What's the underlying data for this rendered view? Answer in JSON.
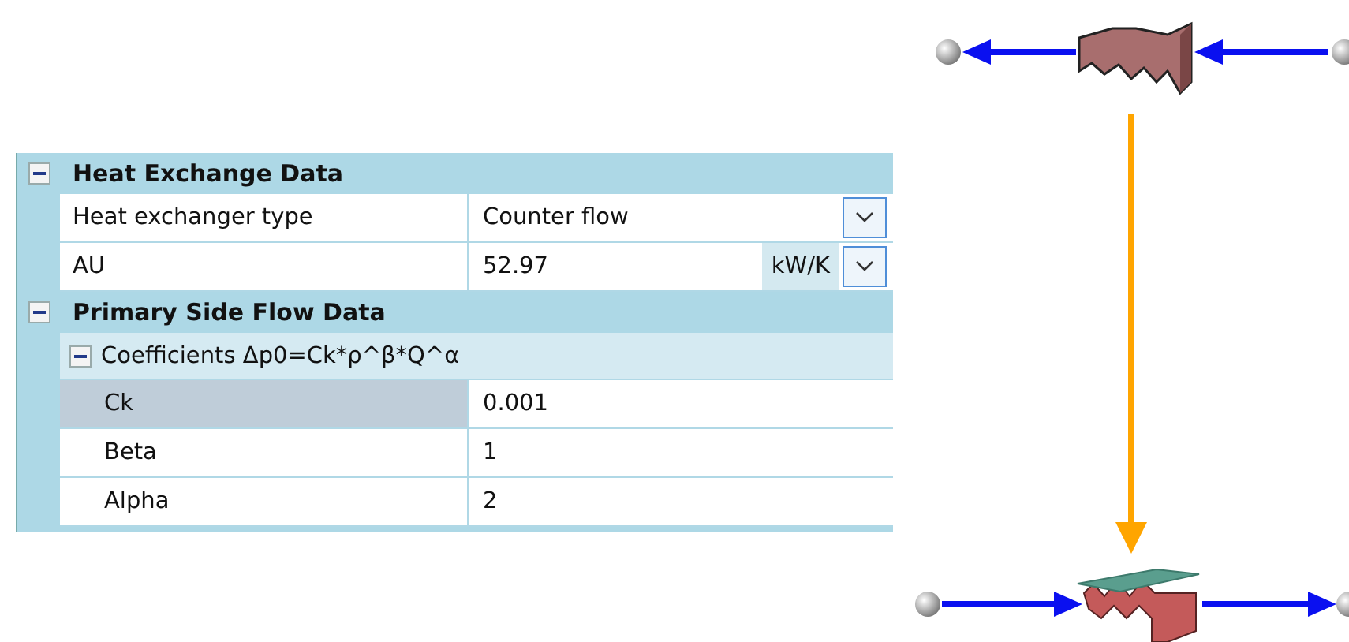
{
  "property_grid": {
    "categories": [
      {
        "title": "Heat Exchange Data",
        "expanded": true,
        "children": [
          {
            "kind": "property",
            "label": "Heat exchanger type",
            "value": "Counter flow",
            "dropdown": true,
            "selected": false
          },
          {
            "kind": "property",
            "label": "AU",
            "value": "52.97",
            "unit": "kW/K",
            "dropdown": true,
            "selected": false
          }
        ]
      },
      {
        "title": "Primary Side Flow Data",
        "expanded": true,
        "children": [
          {
            "kind": "group",
            "title": "Coefficients Δp0=Ck*ρ^β*Q^α",
            "expanded": true,
            "children": [
              {
                "kind": "property",
                "label": "Ck",
                "value": "0.001",
                "dropdown": false,
                "selected": true
              },
              {
                "kind": "property",
                "label": "Beta",
                "value": "1",
                "dropdown": false,
                "selected": false
              },
              {
                "kind": "property",
                "label": "Alpha",
                "value": "2",
                "dropdown": false,
                "selected": false
              }
            ]
          }
        ]
      }
    ]
  }
}
